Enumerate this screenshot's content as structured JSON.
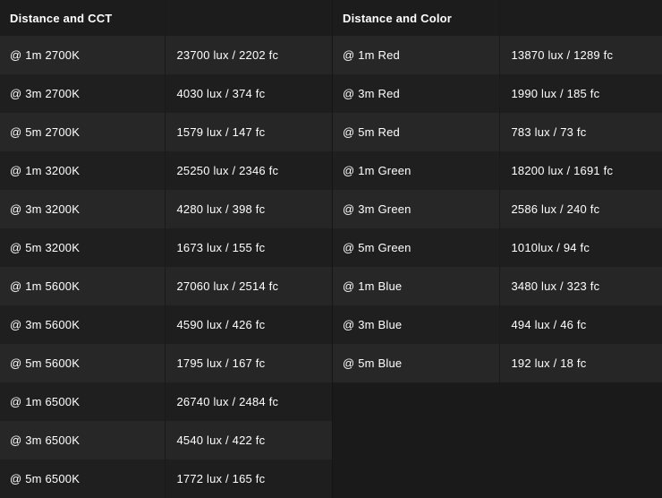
{
  "left_table": {
    "headers": [
      "Distance and CCT",
      ""
    ],
    "rows": [
      [
        "@ 1m 2700K",
        "23700 lux / 2202 fc"
      ],
      [
        "@ 3m 2700K",
        "4030 lux / 374 fc"
      ],
      [
        "@ 5m 2700K",
        "1579 lux / 147 fc"
      ],
      [
        "@ 1m 3200K",
        "25250 lux / 2346 fc"
      ],
      [
        "@ 3m 3200K",
        "4280 lux / 398 fc"
      ],
      [
        "@ 5m 3200K",
        "1673 lux / 155 fc"
      ],
      [
        "@ 1m 5600K",
        "27060 lux / 2514 fc"
      ],
      [
        "@ 3m 5600K",
        "4590 lux / 426 fc"
      ],
      [
        "@ 5m 5600K",
        "1795 lux / 167 fc"
      ],
      [
        "@ 1m 6500K",
        "26740 lux / 2484 fc"
      ],
      [
        "@ 3m 6500K",
        "4540 lux / 422 fc"
      ],
      [
        "@ 5m 6500K",
        "1772 lux / 165 fc"
      ]
    ]
  },
  "right_table": {
    "headers": [
      "Distance and Color",
      ""
    ],
    "rows": [
      [
        "@ 1m Red",
        "13870 lux / 1289 fc"
      ],
      [
        "@ 3m Red",
        "1990 lux / 185 fc"
      ],
      [
        "@ 5m Red",
        "783 lux / 73 fc"
      ],
      [
        "@ 1m Green",
        "18200 lux / 1691 fc"
      ],
      [
        "@ 3m Green",
        "2586 lux / 240 fc"
      ],
      [
        "@ 5m Green",
        "1010lux / 94 fc"
      ],
      [
        "@ 1m Blue",
        "3480 lux / 323 fc"
      ],
      [
        "@ 3m Blue",
        "494 lux / 46 fc"
      ],
      [
        "@ 5m Blue",
        "192 lux / 18 fc"
      ]
    ]
  },
  "colors": {
    "background": "#1a1a1a",
    "row_odd": "#262626",
    "row_even": "#1e1e1e",
    "text": "#ffffff"
  }
}
